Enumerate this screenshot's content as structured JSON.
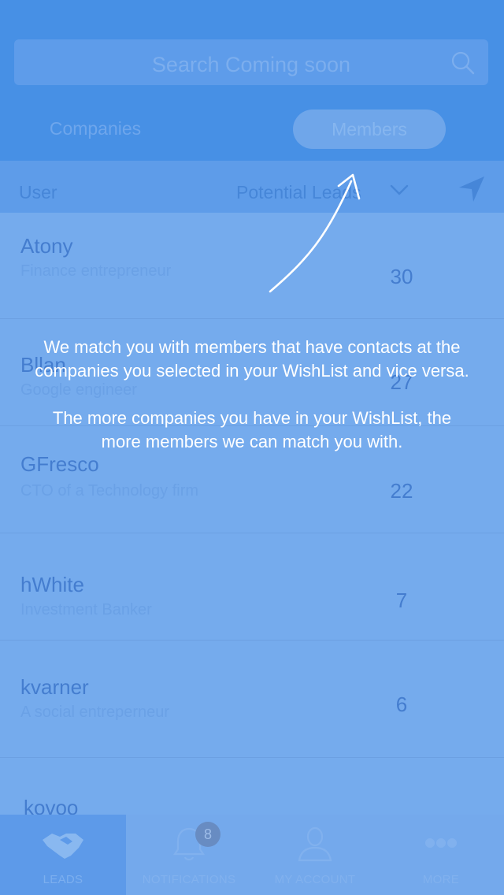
{
  "search": {
    "placeholder": "Search Coming soon"
  },
  "segments": {
    "companies": "Companies",
    "members": "Members",
    "active": "Members"
  },
  "columns": {
    "user": "User",
    "potential_leads": "Potential Leads"
  },
  "members": [
    {
      "name": "Atony",
      "title": "Finance entrepreneur",
      "leads": "30"
    },
    {
      "name": "Bllan",
      "title": "Google engineer",
      "leads": "27"
    },
    {
      "name": "GFresco",
      "title": "CTO of a Technology firm",
      "leads": "22"
    },
    {
      "name": "hWhite",
      "title": "Investment Banker",
      "leads": "7"
    },
    {
      "name": "kvarner",
      "title": "A social entreperneur",
      "leads": "6"
    },
    {
      "name": "kovoo",
      "title": "",
      "leads": ""
    }
  ],
  "coach_mark": {
    "paragraph1": "We match you with members that have contacts at the companies you selected in your WishList and vice versa.",
    "paragraph2": "The more companies you have in your WishList, the more members we can match you with."
  },
  "tabbar": {
    "leads": "LEADS",
    "notifications": "NOTIFICATIONS",
    "notifications_badge": "8",
    "my_account": "MY ACCOUNT",
    "more": "MORE",
    "active": "LEADS"
  },
  "icons": {
    "search": "search-icon",
    "chevron": "chevron-down-icon",
    "location": "location-arrow-icon",
    "leads": "handshake-icon",
    "notifications": "bell-icon",
    "account": "person-icon",
    "more": "more-dots-icon"
  },
  "colors": {
    "header": "#3f8be3",
    "list_bg": "#77aced",
    "overlay_text": "#ffffff"
  }
}
